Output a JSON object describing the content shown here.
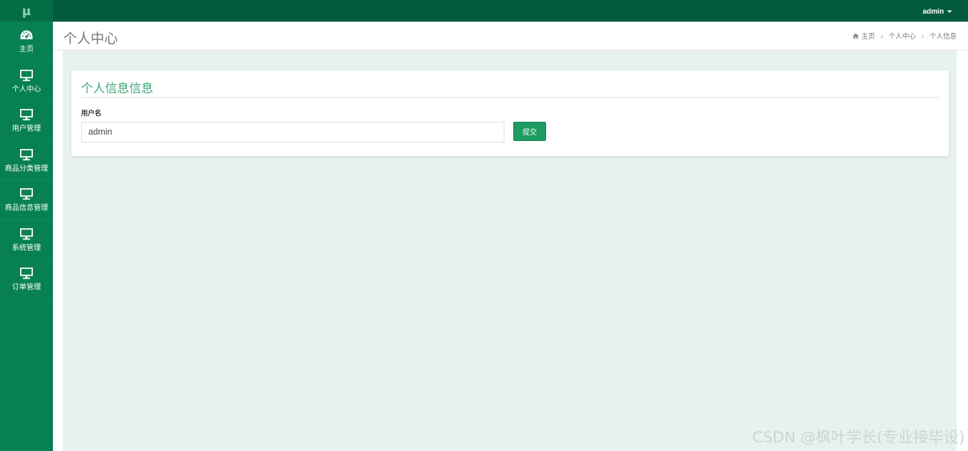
{
  "logo": {
    "text": "μ"
  },
  "sidebar": {
    "items": [
      {
        "label": "主页",
        "icon": "dashboard-icon"
      },
      {
        "label": "个人中心",
        "icon": "monitor-icon"
      },
      {
        "label": "用户管理",
        "icon": "monitor-icon"
      },
      {
        "label": "商品分类管理",
        "icon": "monitor-icon"
      },
      {
        "label": "商品信息管理",
        "icon": "monitor-icon"
      },
      {
        "label": "系统管理",
        "icon": "monitor-icon"
      },
      {
        "label": "订单管理",
        "icon": "monitor-icon"
      }
    ]
  },
  "topbar": {
    "user": "admin"
  },
  "header": {
    "title": "个人中心",
    "breadcrumb": [
      "主页",
      "个人中心",
      "个人信息"
    ]
  },
  "card": {
    "title": "个人信息信息",
    "username_label": "用户名",
    "username_value": "admin",
    "submit_label": "提交"
  },
  "watermark": "CSDN @枫叶学长(专业接毕设)",
  "colors": {
    "sidebar": "#078153",
    "topbar": "#025b3d",
    "accent": "#3ea775",
    "button": "#1e9c62",
    "content_bg": "#e7f2ec"
  }
}
